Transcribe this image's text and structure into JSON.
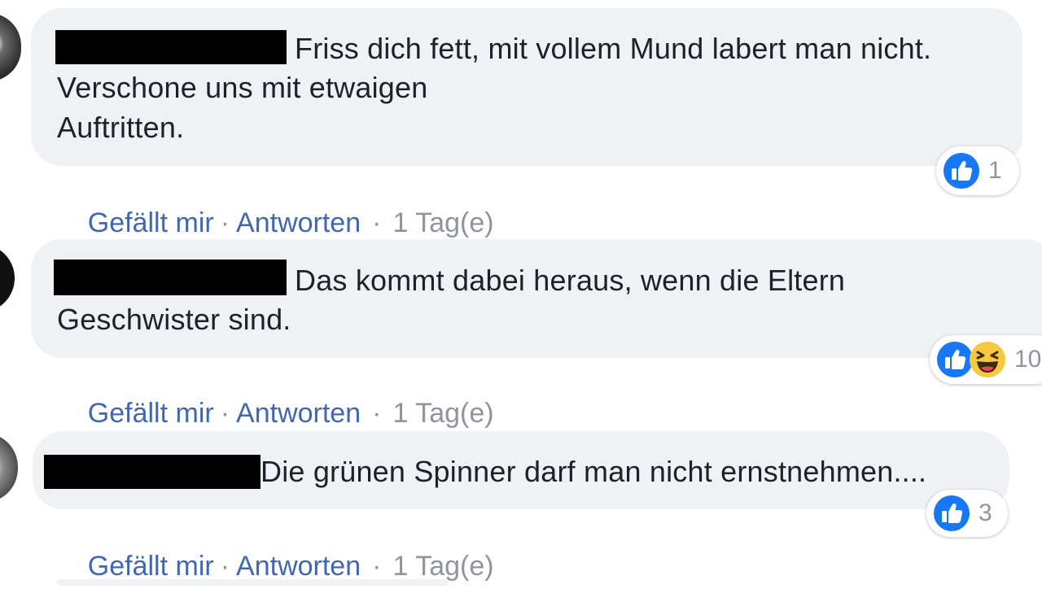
{
  "comments": [
    {
      "text_line1": "Friss dich fett, mit vollem Mund labert man nicht.",
      "text_line2": "Verschone uns mit etwaigen",
      "text_line3": "Auftritten.",
      "reaction_count": "1",
      "reactions": [
        "like-icon"
      ],
      "actions": {
        "like": "Gefällt mir",
        "reply": "Antworten",
        "time": "1 Tag(e)"
      }
    },
    {
      "text_line1": "Das kommt dabei heraus, wenn die Eltern",
      "text_line2": "Geschwister sind.",
      "reaction_count": "10",
      "reactions": [
        "like-icon",
        "haha-icon"
      ],
      "actions": {
        "like": "Gefällt mir",
        "reply": "Antworten",
        "time": "1 Tag(e)"
      }
    },
    {
      "text_line1": "Die grünen Spinner darf man nicht ernstnehmen....",
      "reaction_count": "3",
      "reactions": [
        "like-icon"
      ],
      "actions": {
        "like": "Gefällt mir",
        "reply": "Antworten",
        "time": "1 Tag(e)"
      }
    }
  ],
  "separator": "·",
  "colors": {
    "bubble": "#f0f1f4",
    "link": "#4267b2",
    "meta": "#90949c",
    "text": "#1d2129",
    "like_blue": "#1877f2",
    "haha_yellow": "#f7c93e"
  }
}
